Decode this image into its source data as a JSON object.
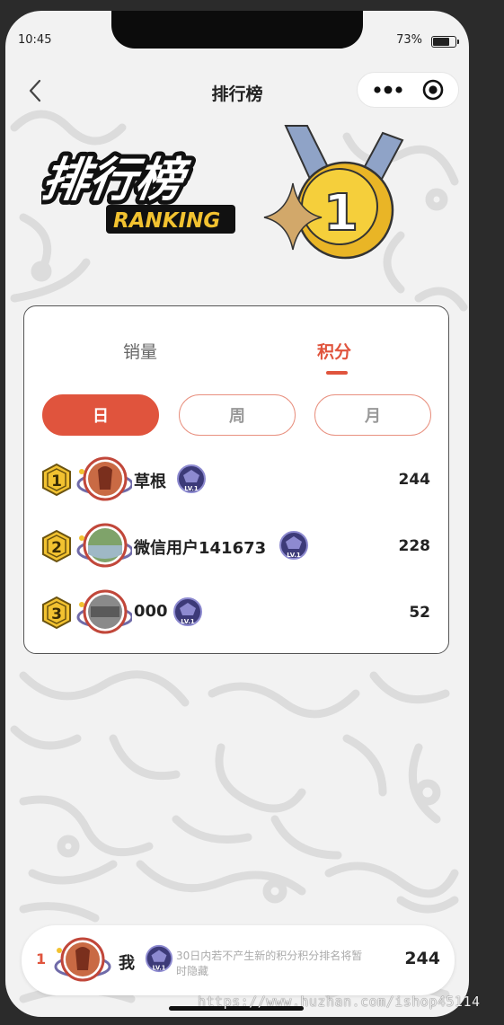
{
  "status_bar": {
    "time": "10:45",
    "battery": "73%"
  },
  "nav": {
    "title": "排行榜"
  },
  "hero": {
    "title": "排行榜",
    "subtitle": "RANKING",
    "medal_number": "1"
  },
  "tabs": [
    {
      "label": "销量"
    },
    {
      "label": "积分",
      "active": true
    }
  ],
  "periods": [
    {
      "label": "日",
      "active": true
    },
    {
      "label": "周"
    },
    {
      "label": "月"
    }
  ],
  "ranking": [
    {
      "rank": "1",
      "name": "草根",
      "score": "244",
      "level": "LV.1"
    },
    {
      "rank": "2",
      "name": "微信用户141673",
      "score": "228",
      "level": "LV.1"
    },
    {
      "rank": "3",
      "name": "000",
      "score": "52",
      "level": "LV.1"
    }
  ],
  "me": {
    "rank": "1",
    "name": "我",
    "level": "LV.1",
    "note": "30日内若不产生新的积分积分排名将暂时隐藏",
    "score": "244"
  },
  "watermark": "https://www.huzhan.com/ishop45114",
  "colors": {
    "accent": "#e0543d",
    "gold": "#f2c230",
    "lv_badge": "#3c3a78"
  }
}
